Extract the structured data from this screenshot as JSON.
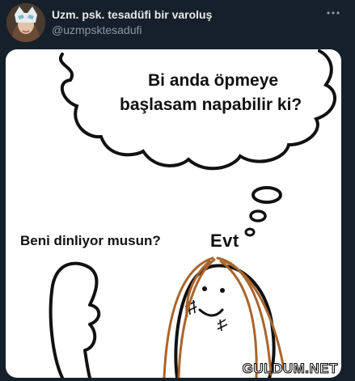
{
  "tweet": {
    "display_name": "Uzm. psk. tesadüfi bir varoluş",
    "handle": "@uzmpsktesadufi",
    "more_icon": "more-horizontal-icon"
  },
  "meme": {
    "thought_line1": "Bi anda öpmeye",
    "thought_line2": "başlasam napabilir ki?",
    "speech_text": "Beni dinliyor musun?",
    "reply_text": "Evt",
    "watermark": "GULDUM.NET"
  },
  "colors": {
    "background": "#15202b",
    "hair": "#a9652c"
  }
}
